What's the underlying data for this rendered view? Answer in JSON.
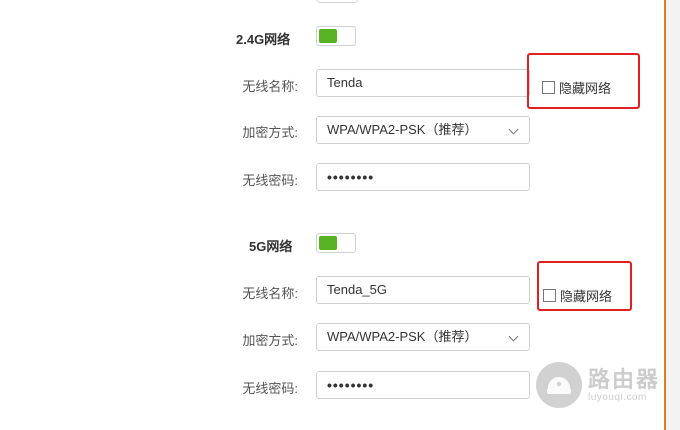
{
  "sections": [
    {
      "title": "2.4G网络",
      "enabled": true,
      "ssid_label": "无线名称:",
      "ssid_value": "Tenda",
      "hide_label": "隐藏网络",
      "hide_checked": false,
      "enc_label": "加密方式:",
      "enc_value": "WPA/WPA2-PSK（推荐）",
      "pwd_label": "无线密码:",
      "pwd_value": "••••••••"
    },
    {
      "title": "5G网络",
      "enabled": true,
      "ssid_label": "无线名称:",
      "ssid_value": "Tenda_5G",
      "hide_label": "隐藏网络",
      "hide_checked": false,
      "enc_label": "加密方式:",
      "enc_value": "WPA/WPA2-PSK（推荐）",
      "pwd_label": "无线密码:",
      "pwd_value": "••••••••"
    }
  ],
  "colors": {
    "toggle_on": "#58b324",
    "highlight": "#e02020",
    "accent_edge": "#e07a25"
  },
  "watermark": {
    "main": "路由器",
    "sub": "luyouqi.com",
    "icon": "router-logo-icon"
  }
}
